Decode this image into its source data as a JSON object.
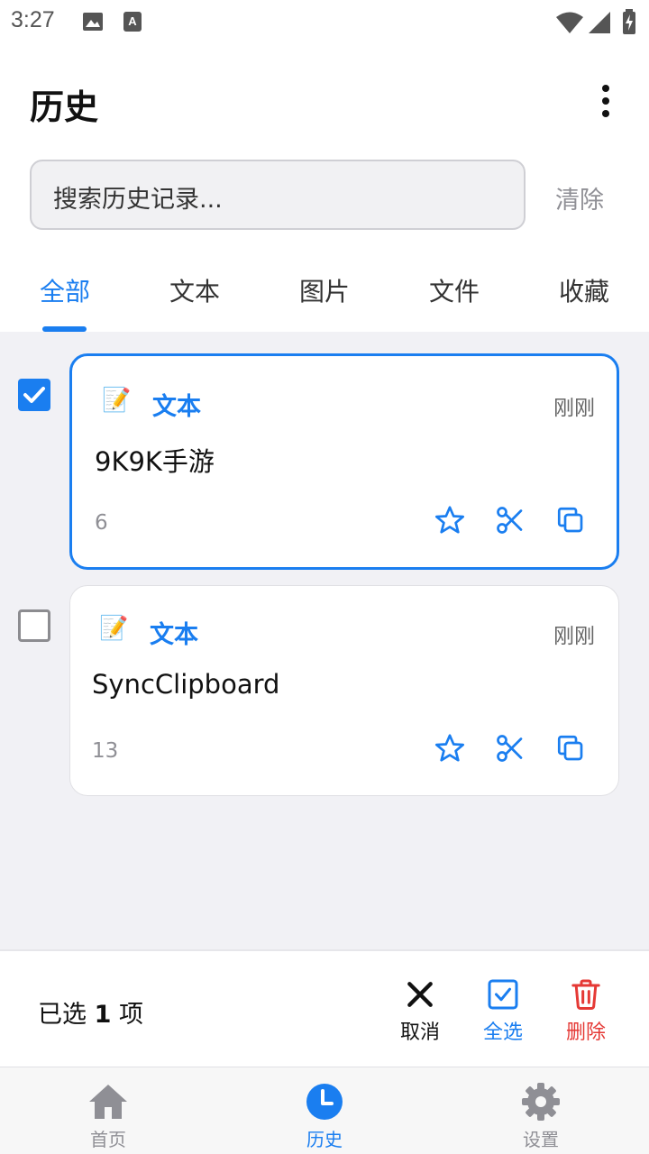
{
  "status_bar": {
    "time": "3:27"
  },
  "header": {
    "title": "历史"
  },
  "search": {
    "placeholder": "搜索历史记录...",
    "clear_label": "清除"
  },
  "tabs": [
    {
      "label": "全部",
      "active": true
    },
    {
      "label": "文本",
      "active": false
    },
    {
      "label": "图片",
      "active": false
    },
    {
      "label": "文件",
      "active": false
    },
    {
      "label": "收藏",
      "active": false
    }
  ],
  "items": [
    {
      "type_icon": "memo-icon",
      "type_label": "文本",
      "time": "刚刚",
      "content": "9K9K手游",
      "count": "6",
      "selected": true
    },
    {
      "type_icon": "memo-icon",
      "type_label": "文本",
      "time": "刚刚",
      "content": "SyncClipboard",
      "count": "13",
      "selected": false
    }
  ],
  "selection_bar": {
    "prefix": "已选",
    "count": "1",
    "suffix": "项",
    "cancel_label": "取消",
    "select_all_label": "全选",
    "delete_label": "删除"
  },
  "bottom_nav": [
    {
      "icon": "home-icon",
      "label": "首页",
      "active": false
    },
    {
      "icon": "clock-icon",
      "label": "历史",
      "active": true
    },
    {
      "icon": "gear-icon",
      "label": "设置",
      "active": false
    }
  ],
  "colors": {
    "accent": "#1a7ef0",
    "danger": "#e53935",
    "muted": "#8f8f95"
  }
}
